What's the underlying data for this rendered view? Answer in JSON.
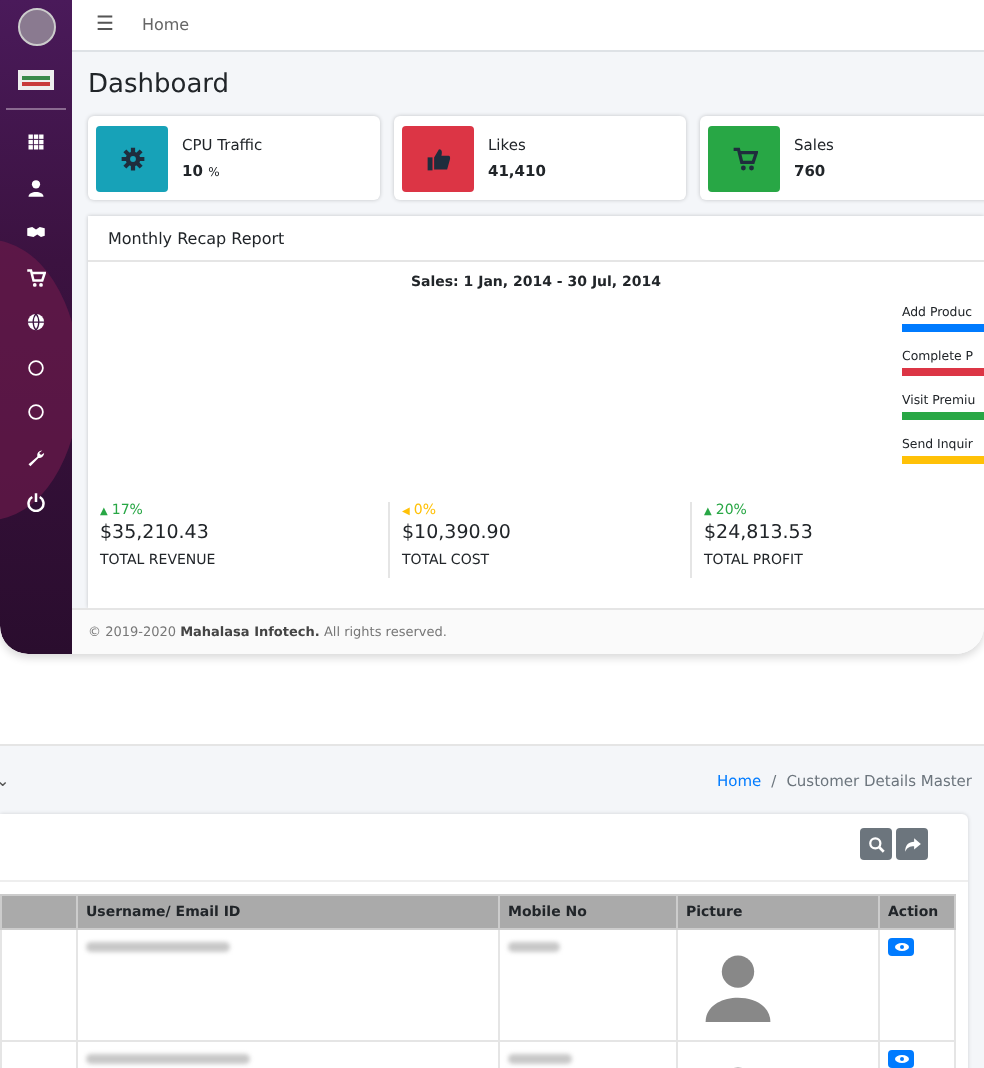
{
  "dashboard": {
    "topbar": {
      "menu": "☰",
      "breadcrumb": "Home"
    },
    "sidebar": {
      "items": [
        {
          "kind": "grid"
        },
        {
          "kind": "user"
        },
        {
          "kind": "handshake"
        },
        {
          "kind": "cart"
        },
        {
          "kind": "globe"
        },
        {
          "kind": "circle"
        },
        {
          "kind": "circle"
        },
        {
          "kind": "wrench"
        },
        {
          "kind": "power"
        }
      ]
    },
    "title": "Dashboard",
    "info_boxes": [
      {
        "kind": "gear",
        "color": "#17a2b8",
        "label": "CPU Traffic",
        "value": "10",
        "unit": "%"
      },
      {
        "kind": "thumb",
        "color": "#dc3545",
        "label": "Likes",
        "value": "41,410"
      },
      {
        "kind": "cart",
        "color": "#28a745",
        "label": "Sales",
        "value": "760"
      }
    ],
    "report": {
      "title": "Monthly Recap Report",
      "chart_title": "Sales: 1 Jan, 2014 - 30 Jul, 2014",
      "goals": [
        {
          "label": "Add Produc",
          "color": "#007bff"
        },
        {
          "label": "Complete P",
          "color": "#dc3545"
        },
        {
          "label": "Visit Premiu",
          "color": "#28a745"
        },
        {
          "label": "Send Inquir",
          "color": "#ffc107"
        }
      ],
      "stats": [
        {
          "arrow": "▲",
          "color": "#28a745",
          "change": "17%",
          "amount": "$35,210.43",
          "label": "TOTAL REVENUE"
        },
        {
          "arrow": "◀",
          "color": "#ffc107",
          "change": "0%",
          "amount": "$10,390.90",
          "label": "TOTAL COST"
        },
        {
          "arrow": "▲",
          "color": "#28a745",
          "change": "20%",
          "amount": "$24,813.53",
          "label": "TOTAL PROFIT"
        }
      ]
    },
    "footer": {
      "prefix": "© 2019-2020",
      "company": "Mahalasa Infotech.",
      "suffix": "All rights reserved."
    }
  },
  "customers": {
    "caret": "⌄",
    "breadcrumb": {
      "home": "Home",
      "separator": "/",
      "current": "Customer Details Master"
    },
    "table": {
      "columns": [
        "Username/ Email ID",
        "Mobile No",
        "Picture",
        "Action"
      ]
    }
  }
}
